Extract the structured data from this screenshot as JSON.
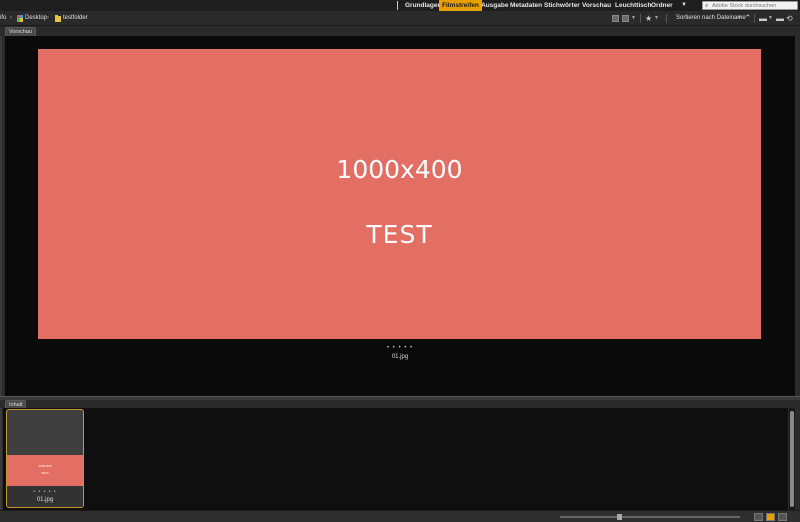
{
  "workspaces": {
    "items": [
      "Grundlagen",
      "Filmstreifen",
      "Ausgabe",
      "Metadaten",
      "Stichwörter",
      "Vorschau",
      "Leuchttisch",
      "Ordner"
    ],
    "active": "Filmstreifen",
    "more_glyph": "▼"
  },
  "search": {
    "placeholder": "Adobe Stock durchsuchen"
  },
  "path": {
    "clipped_label": "ifo",
    "items": [
      "Desktop",
      "testfolder"
    ]
  },
  "sort": {
    "label": "Sortieren nach Dateiname"
  },
  "panels": {
    "preview_tab": "Vorschau",
    "content_tab": "Inhalt"
  },
  "preview": {
    "image_line1": "1000x400",
    "image_line2": "TEST",
    "rating_dots": "• • • • •",
    "filename": "01.jpg",
    "image_color": "#e26e64"
  },
  "thumbnail": {
    "filename": "01.jpg",
    "rating_dots": "• • • • •",
    "image_line1": "1000x400",
    "image_line2": "TEST",
    "selected": true
  },
  "colors": {
    "accent": "#e8a000",
    "selection_border": "#c8962e"
  }
}
